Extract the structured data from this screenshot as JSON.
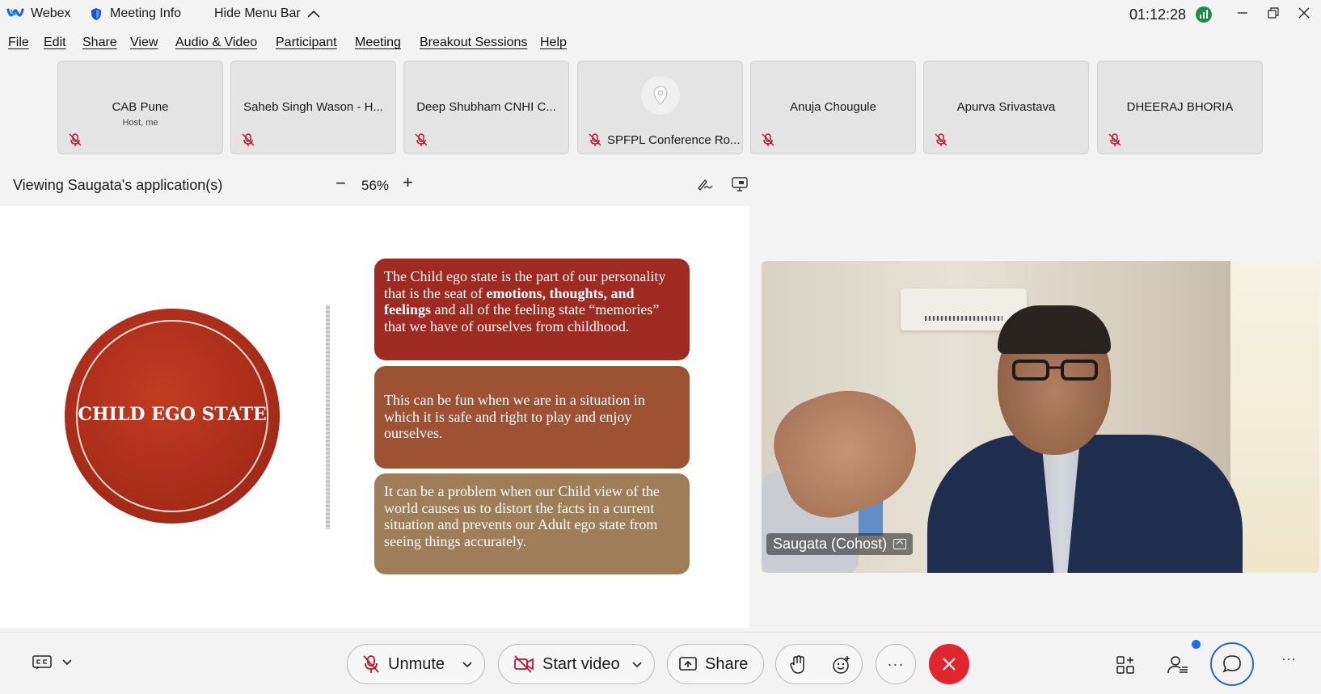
{
  "titlebar": {
    "app_name": "Webex",
    "meeting_info": "Meeting Info",
    "hide_menu_bar": "Hide Menu Bar",
    "clock": "01:12:28"
  },
  "menu": {
    "items": [
      "File",
      "Edit",
      "Share",
      "View",
      "Audio & Video",
      "Participant",
      "Meeting",
      "Breakout Sessions",
      "Help"
    ]
  },
  "participants": [
    {
      "name": "CAB Pune",
      "sub": "Host, me",
      "muted": true
    },
    {
      "name": "Saheb Singh Wason - H...",
      "muted": true
    },
    {
      "name": "Deep Shubham CNHI C...",
      "muted": true
    },
    {
      "name": "SPFPL Conference Ro...",
      "muted": true,
      "icon": "location-pin-icon"
    },
    {
      "name": "Anuja Chougule",
      "muted": true
    },
    {
      "name": "Apurva Srivastava",
      "muted": true
    },
    {
      "name": "DHEERAJ BHORIA",
      "muted": true
    }
  ],
  "share": {
    "viewing_label": "Viewing Saugata's application(s)",
    "zoom_minus": "−",
    "zoom_level": "56%",
    "zoom_plus": "+"
  },
  "slide": {
    "circle_title": "CHILD EGO STATE",
    "box1_part1": "The Child ego state is the part of our personality that is the seat of ",
    "box1_bold": "emotions, thoughts, and feelings",
    "box1_part2": " and all of the feeling state “memories” that we have of ourselves from childhood.",
    "box2": "This can be fun when we are in a situation in which it is safe and right to play and enjoy ourselves.",
    "box3": "It can be a problem when our Child view of the world causes us to distort the facts in a current situation and prevents our Adult ego state from seeing things accurately.",
    "colors": {
      "circle": "#a32a18",
      "box1": "#9e2a22",
      "box2": "#9c5233",
      "box3": "#9e7d58"
    }
  },
  "video": {
    "speaker_label": "Saugata (Cohost)"
  },
  "toolbar": {
    "unmute": "Unmute",
    "start_video": "Start video",
    "share": "Share",
    "more": "···",
    "overflow": "···",
    "end_color": "#e0262e",
    "accent": "#2a66c9"
  }
}
